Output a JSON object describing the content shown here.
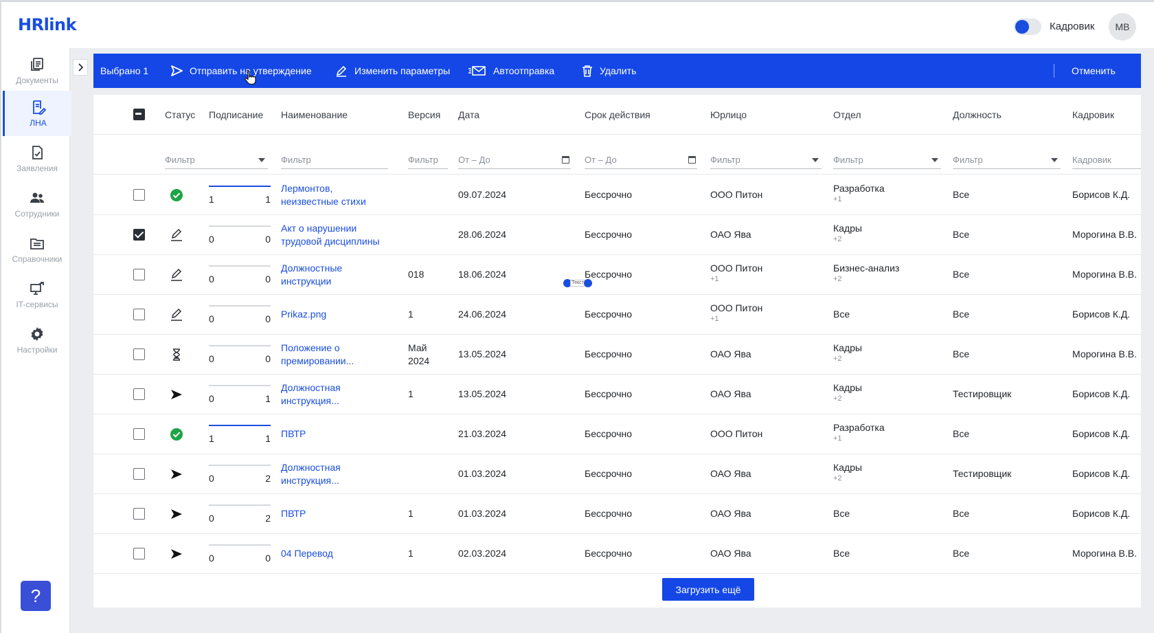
{
  "header": {
    "logo": "HRlink",
    "role_label": "Кадровик",
    "avatar_initials": "МВ",
    "accent": "#1447e6"
  },
  "sidebar": {
    "items": [
      {
        "label": "Документы",
        "icon": "documents-icon"
      },
      {
        "label": "ЛНА",
        "icon": "lna-icon",
        "active": true
      },
      {
        "label": "Заявления",
        "icon": "applications-icon"
      },
      {
        "label": "Сотрудники",
        "icon": "employees-icon"
      },
      {
        "label": "Справочники",
        "icon": "directories-icon"
      },
      {
        "label": "IT-сервисы",
        "icon": "it-services-icon"
      },
      {
        "label": "Настройки",
        "icon": "settings-icon"
      }
    ],
    "help_label": "?"
  },
  "actionbar": {
    "selected": "Выбрано 1",
    "send": "Отправить на утверждение",
    "edit": "Изменить параметры",
    "auto": "Автоотправка",
    "delete": "Удалить",
    "cancel": "Отменить"
  },
  "table": {
    "columns": [
      "Статус",
      "Подписание",
      "Наименование",
      "Версия",
      "Дата",
      "Срок действия",
      "Юрлицо",
      "Отдел",
      "Должность",
      "Кадровик"
    ],
    "filters": {
      "status": "Фильтр",
      "name": "Фильтр",
      "version": "Фильтр",
      "date": "От – До",
      "validity": "От – До",
      "entity": "Фильтр",
      "department": "Фильтр",
      "position": "Фильтр",
      "hr": "Кадровик"
    },
    "rows": [
      {
        "status": "signed",
        "sign_left": "1",
        "sign_right": "1",
        "sign_full": true,
        "name": "Лермонтов, неизвестные стихи",
        "version": "",
        "date": "09.07.2024",
        "validity": "Бессрочно",
        "entity": "ООО Питон",
        "entity_sub": "",
        "department": "Разработка",
        "department_sub": "+1",
        "position": "Все",
        "hr": "Борисов К.Д.",
        "checked": false
      },
      {
        "status": "draft",
        "sign_left": "0",
        "sign_right": "0",
        "sign_full": false,
        "name": "Акт о нарушении трудовой дисциплины",
        "version": "",
        "date": "28.06.2024",
        "validity": "Бессрочно",
        "entity": "ОАО Ява",
        "entity_sub": "",
        "department": "Кадры",
        "department_sub": "+2",
        "position": "Все",
        "hr": "Морогина В.В.",
        "checked": true
      },
      {
        "status": "draft",
        "sign_left": "0",
        "sign_right": "0",
        "sign_full": false,
        "name": "Должностные инструкции",
        "version": "018",
        "date": "18.06.2024",
        "validity": "Бессрочно",
        "entity": "ООО Питон",
        "entity_sub": "+1",
        "department": "Бизнес-анализ",
        "department_sub": "+2",
        "position": "Все",
        "hr": "Морогина В.В.",
        "checked": false
      },
      {
        "status": "draft",
        "sign_left": "0",
        "sign_right": "0",
        "sign_full": false,
        "name": "Prikaz.png",
        "version": "1",
        "date": "24.06.2024",
        "validity": "Бессрочно",
        "entity": "ООО Питон",
        "entity_sub": "+1",
        "department": "Все",
        "department_sub": "",
        "position": "Все",
        "hr": "Борисов К.Д.",
        "checked": false
      },
      {
        "status": "pending",
        "sign_left": "0",
        "sign_right": "0",
        "sign_full": false,
        "name": "Положение о премировании...",
        "version": "Май 2024",
        "date": "13.05.2024",
        "validity": "Бессрочно",
        "entity": "ОАО Ява",
        "entity_sub": "",
        "department": "Кадры",
        "department_sub": "+2",
        "position": "Все",
        "hr": "Морогина В.В.",
        "checked": false
      },
      {
        "status": "sent",
        "sign_left": "0",
        "sign_right": "1",
        "sign_full": false,
        "name": "Должностная инструкция...",
        "version": "1",
        "date": "13.05.2024",
        "validity": "Бессрочно",
        "entity": "ОАО Ява",
        "entity_sub": "",
        "department": "Кадры",
        "department_sub": "+2",
        "position": "Тестировщик",
        "hr": "Борисов К.Д.",
        "checked": false
      },
      {
        "status": "signed",
        "sign_left": "1",
        "sign_right": "1",
        "sign_full": true,
        "name": "ПВТР",
        "version": "",
        "date": "21.03.2024",
        "validity": "Бессрочно",
        "entity": "ООО Питон",
        "entity_sub": "",
        "department": "Разработка",
        "department_sub": "+1",
        "position": "Все",
        "hr": "Борисов К.Д.",
        "checked": false
      },
      {
        "status": "sent",
        "sign_left": "0",
        "sign_right": "2",
        "sign_full": false,
        "name": "Должностная инструкция...",
        "version": "",
        "date": "01.03.2024",
        "validity": "Бессрочно",
        "entity": "ОАО Ява",
        "entity_sub": "",
        "department": "Кадры",
        "department_sub": "+2",
        "position": "Тестировщик",
        "hr": "Борисов К.Д.",
        "checked": false
      },
      {
        "status": "sent",
        "sign_left": "0",
        "sign_right": "2",
        "sign_full": false,
        "name": "ПВТР",
        "version": "1",
        "date": "01.03.2024",
        "validity": "Бессрочно",
        "entity": "ОАО Ява",
        "entity_sub": "",
        "department": "Все",
        "department_sub": "",
        "position": "Все",
        "hr": "Борисов К.Д.",
        "checked": false
      },
      {
        "status": "sent",
        "sign_left": "0",
        "sign_right": "0",
        "sign_full": false,
        "name": "04 Перевод",
        "version": "1",
        "date": "02.03.2024",
        "validity": "Бессрочно",
        "entity": "ОАО Ява",
        "entity_sub": "",
        "department": "Все",
        "department_sub": "",
        "position": "Все",
        "hr": "Морогина В.В.",
        "checked": false
      }
    ],
    "load_more": "Загрузить ещё",
    "text_handle": "Текст"
  }
}
